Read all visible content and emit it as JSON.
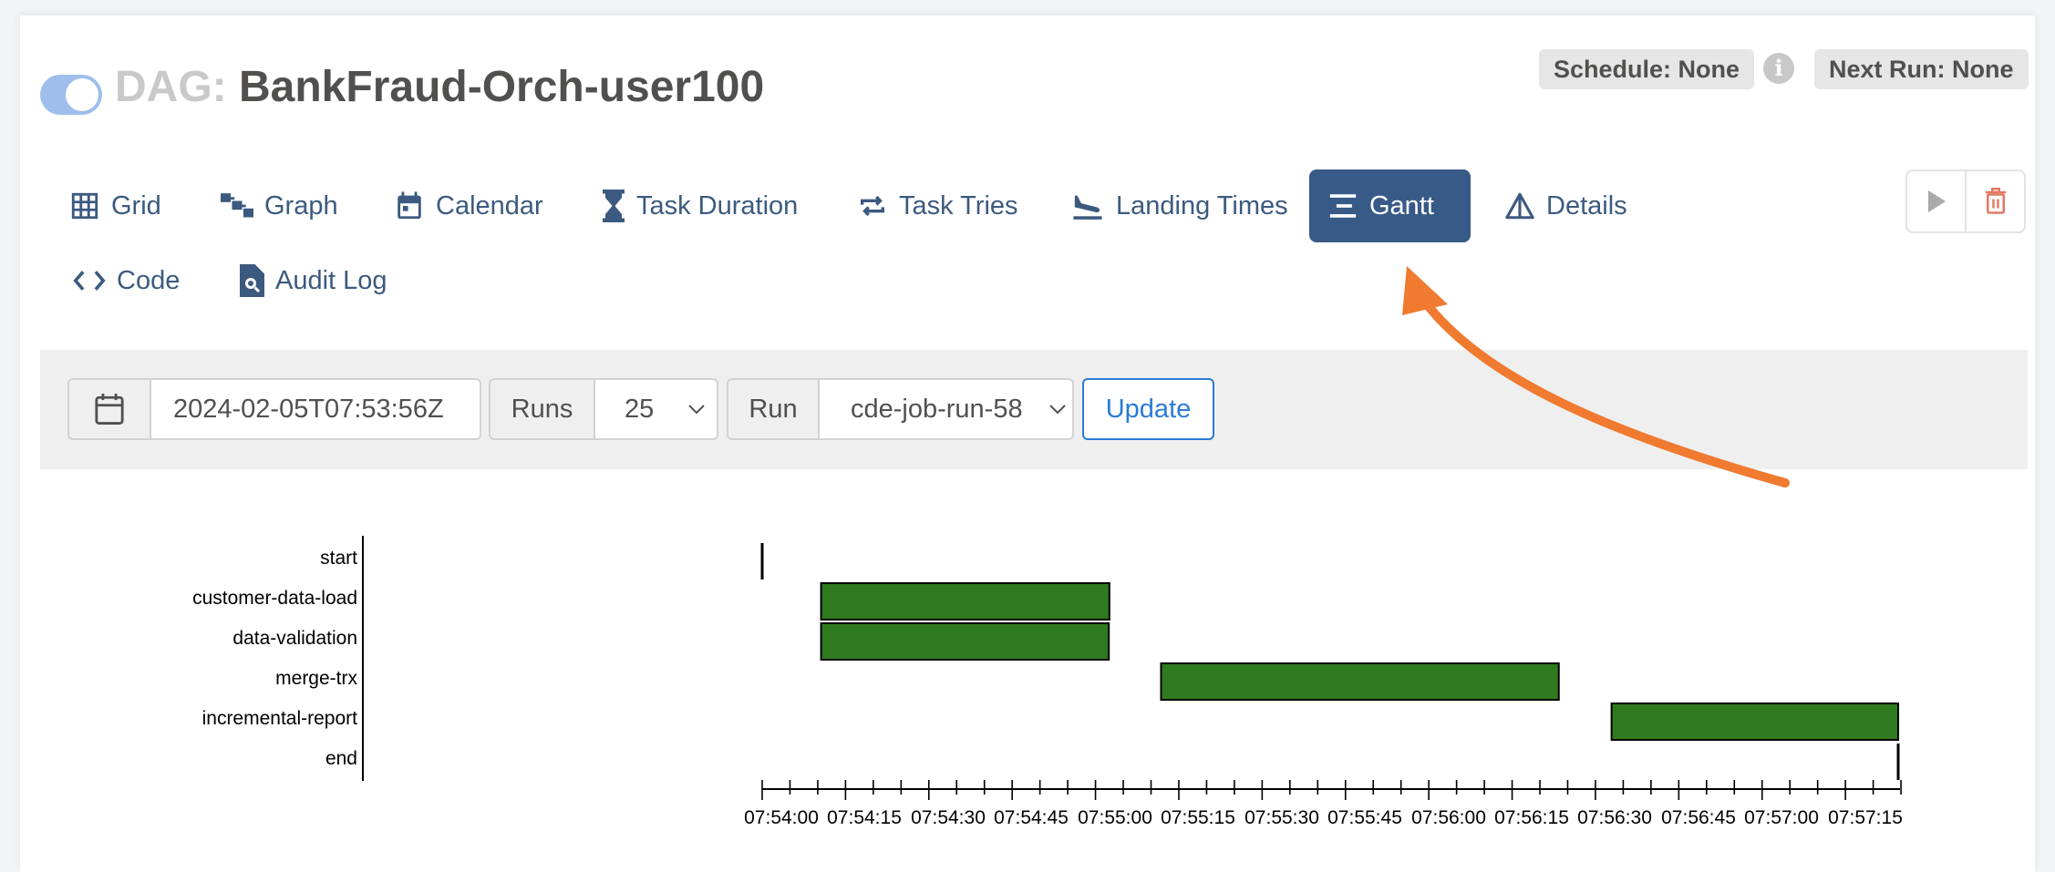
{
  "header": {
    "dag_prefix": "DAG:",
    "dag_name": "BankFraud-Orch-user100",
    "schedule": "Schedule: None",
    "next_run": "Next Run: None",
    "paused": false
  },
  "tabs": [
    {
      "label": "Grid",
      "icon": "grid-icon"
    },
    {
      "label": "Graph",
      "icon": "graph-icon"
    },
    {
      "label": "Calendar",
      "icon": "calendar-icon"
    },
    {
      "label": "Task Duration",
      "icon": "hourglass-icon"
    },
    {
      "label": "Task Tries",
      "icon": "repeat-icon"
    },
    {
      "label": "Landing Times",
      "icon": "plane-landing-icon"
    },
    {
      "label": "Gantt",
      "icon": "gantt-icon",
      "active": true
    },
    {
      "label": "Details",
      "icon": "triangle-icon"
    },
    {
      "label": "Code",
      "icon": "code-icon"
    },
    {
      "label": "Audit Log",
      "icon": "file-search-icon"
    }
  ],
  "actions": [
    "trigger-dag-button",
    "delete-dag-button"
  ],
  "filters": {
    "date_value": "2024-02-05T07:53:56Z",
    "runs_label": "Runs",
    "runs_value": "25",
    "run_label": "Run",
    "run_value": "cde-job-run-58",
    "update_label": "Update"
  },
  "colors": {
    "accent": "#385a87",
    "bar_success": "#2f7a1f",
    "annotation_arrow": "#ef7a30"
  },
  "chart_data": {
    "type": "gantt",
    "x_axis_start": "07:54:00",
    "x_axis_end": "07:57:20",
    "tick_labels": [
      "07:54:00",
      "07:54:15",
      "07:54:30",
      "07:54:45",
      "07:55:00",
      "07:55:15",
      "07:55:30",
      "07:55:45",
      "07:56:00",
      "07:56:15",
      "07:56:30",
      "07:56:45",
      "07:57:00",
      "07:57:15"
    ],
    "tasks": [
      {
        "name": "start",
        "start_s": 0.0,
        "end_s": 0.0
      },
      {
        "name": "customer-data-load",
        "start_s": 10.6,
        "end_s": 62.5
      },
      {
        "name": "data-validation",
        "start_s": 10.6,
        "end_s": 62.4
      },
      {
        "name": "merge-trx",
        "start_s": 71.8,
        "end_s": 143.4
      },
      {
        "name": "incremental-report",
        "start_s": 152.9,
        "end_s": 204.5
      },
      {
        "name": "end",
        "start_s": 204.5,
        "end_s": 204.5
      }
    ]
  }
}
